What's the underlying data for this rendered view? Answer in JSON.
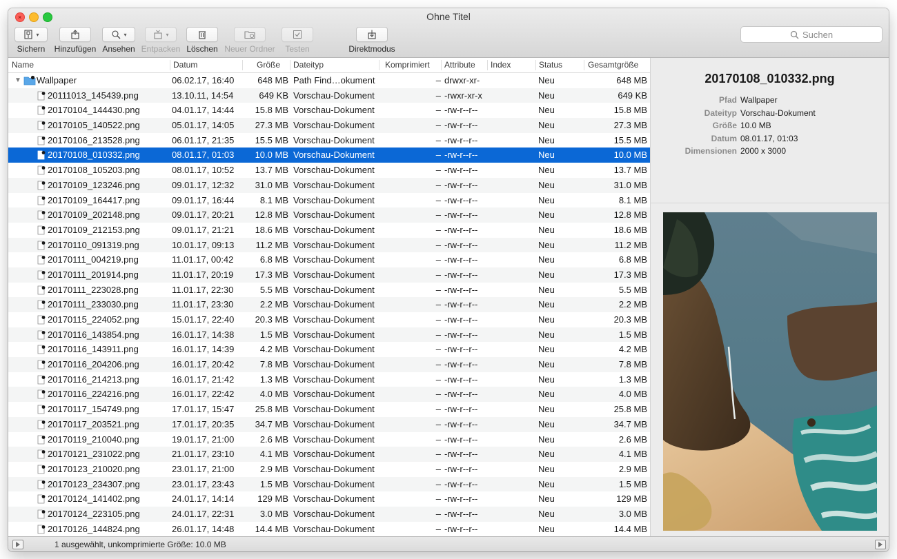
{
  "window": {
    "title": "Ohne Titel"
  },
  "toolbar": {
    "items": [
      {
        "label": "Sichern",
        "icon": "archive-icon",
        "enabled": true,
        "dropdown": true
      },
      {
        "label": "Hinzufügen",
        "icon": "add-icon",
        "enabled": true
      },
      {
        "label": "Ansehen",
        "icon": "view-icon",
        "enabled": true,
        "dropdown": true
      },
      {
        "label": "Entpacken",
        "icon": "extract-icon",
        "enabled": false,
        "dropdown": true
      },
      {
        "label": "Löschen",
        "icon": "trash-icon",
        "enabled": true
      },
      {
        "label": "Neuer Ordner",
        "icon": "new-folder-icon",
        "enabled": false
      },
      {
        "label": "Testen",
        "icon": "checkmark-icon",
        "enabled": false
      },
      {
        "label": "Direktmodus",
        "icon": "direct-mode-icon",
        "enabled": true
      }
    ],
    "search_placeholder": "Suchen"
  },
  "columns": [
    "Name",
    "Datum",
    "Größe",
    "Dateityp",
    "Komprimiert",
    "Attribute",
    "Index",
    "Status",
    "Gesamtgröße"
  ],
  "folder": {
    "name": "Wallpaper",
    "date": "06.02.17, 16:40",
    "size": "648 MB",
    "type": "Path Find…okument",
    "compressed": "–",
    "attr": "drwxr-xr-",
    "status": "Neu",
    "total": "648 MB"
  },
  "rows": [
    {
      "name": "20111013_145439.png",
      "date": "13.10.11, 14:54",
      "size": "649 KB",
      "type": "Vorschau-Dokument",
      "compressed": "–",
      "attr": "-rwxr-xr-x",
      "status": "Neu",
      "total": "649 KB"
    },
    {
      "name": "20170104_144430.png",
      "date": "04.01.17, 14:44",
      "size": "15.8 MB",
      "type": "Vorschau-Dokument",
      "compressed": "–",
      "attr": "-rw-r--r--",
      "status": "Neu",
      "total": "15.8 MB"
    },
    {
      "name": "20170105_140522.png",
      "date": "05.01.17, 14:05",
      "size": "27.3 MB",
      "type": "Vorschau-Dokument",
      "compressed": "–",
      "attr": "-rw-r--r--",
      "status": "Neu",
      "total": "27.3 MB"
    },
    {
      "name": "20170106_213528.png",
      "date": "06.01.17, 21:35",
      "size": "15.5 MB",
      "type": "Vorschau-Dokument",
      "compressed": "–",
      "attr": "-rw-r--r--",
      "status": "Neu",
      "total": "15.5 MB"
    },
    {
      "name": "20170108_010332.png",
      "date": "08.01.17, 01:03",
      "size": "10.0 MB",
      "type": "Vorschau-Dokument",
      "compressed": "–",
      "attr": "-rw-r--r--",
      "status": "Neu",
      "total": "10.0 MB",
      "selected": true
    },
    {
      "name": "20170108_105203.png",
      "date": "08.01.17, 10:52",
      "size": "13.7 MB",
      "type": "Vorschau-Dokument",
      "compressed": "–",
      "attr": "-rw-r--r--",
      "status": "Neu",
      "total": "13.7 MB"
    },
    {
      "name": "20170109_123246.png",
      "date": "09.01.17, 12:32",
      "size": "31.0 MB",
      "type": "Vorschau-Dokument",
      "compressed": "–",
      "attr": "-rw-r--r--",
      "status": "Neu",
      "total": "31.0 MB"
    },
    {
      "name": "20170109_164417.png",
      "date": "09.01.17, 16:44",
      "size": "8.1 MB",
      "type": "Vorschau-Dokument",
      "compressed": "–",
      "attr": "-rw-r--r--",
      "status": "Neu",
      "total": "8.1 MB"
    },
    {
      "name": "20170109_202148.png",
      "date": "09.01.17, 20:21",
      "size": "12.8 MB",
      "type": "Vorschau-Dokument",
      "compressed": "–",
      "attr": "-rw-r--r--",
      "status": "Neu",
      "total": "12.8 MB"
    },
    {
      "name": "20170109_212153.png",
      "date": "09.01.17, 21:21",
      "size": "18.6 MB",
      "type": "Vorschau-Dokument",
      "compressed": "–",
      "attr": "-rw-r--r--",
      "status": "Neu",
      "total": "18.6 MB"
    },
    {
      "name": "20170110_091319.png",
      "date": "10.01.17, 09:13",
      "size": "11.2 MB",
      "type": "Vorschau-Dokument",
      "compressed": "–",
      "attr": "-rw-r--r--",
      "status": "Neu",
      "total": "11.2 MB"
    },
    {
      "name": "20170111_004219.png",
      "date": "11.01.17, 00:42",
      "size": "6.8 MB",
      "type": "Vorschau-Dokument",
      "compressed": "–",
      "attr": "-rw-r--r--",
      "status": "Neu",
      "total": "6.8 MB"
    },
    {
      "name": "20170111_201914.png",
      "date": "11.01.17, 20:19",
      "size": "17.3 MB",
      "type": "Vorschau-Dokument",
      "compressed": "–",
      "attr": "-rw-r--r--",
      "status": "Neu",
      "total": "17.3 MB"
    },
    {
      "name": "20170111_223028.png",
      "date": "11.01.17, 22:30",
      "size": "5.5 MB",
      "type": "Vorschau-Dokument",
      "compressed": "–",
      "attr": "-rw-r--r--",
      "status": "Neu",
      "total": "5.5 MB"
    },
    {
      "name": "20170111_233030.png",
      "date": "11.01.17, 23:30",
      "size": "2.2 MB",
      "type": "Vorschau-Dokument",
      "compressed": "–",
      "attr": "-rw-r--r--",
      "status": "Neu",
      "total": "2.2 MB"
    },
    {
      "name": "20170115_224052.png",
      "date": "15.01.17, 22:40",
      "size": "20.3 MB",
      "type": "Vorschau-Dokument",
      "compressed": "–",
      "attr": "-rw-r--r--",
      "status": "Neu",
      "total": "20.3 MB"
    },
    {
      "name": "20170116_143854.png",
      "date": "16.01.17, 14:38",
      "size": "1.5 MB",
      "type": "Vorschau-Dokument",
      "compressed": "–",
      "attr": "-rw-r--r--",
      "status": "Neu",
      "total": "1.5 MB"
    },
    {
      "name": "20170116_143911.png",
      "date": "16.01.17, 14:39",
      "size": "4.2 MB",
      "type": "Vorschau-Dokument",
      "compressed": "–",
      "attr": "-rw-r--r--",
      "status": "Neu",
      "total": "4.2 MB"
    },
    {
      "name": "20170116_204206.png",
      "date": "16.01.17, 20:42",
      "size": "7.8 MB",
      "type": "Vorschau-Dokument",
      "compressed": "–",
      "attr": "-rw-r--r--",
      "status": "Neu",
      "total": "7.8 MB"
    },
    {
      "name": "20170116_214213.png",
      "date": "16.01.17, 21:42",
      "size": "1.3 MB",
      "type": "Vorschau-Dokument",
      "compressed": "–",
      "attr": "-rw-r--r--",
      "status": "Neu",
      "total": "1.3 MB"
    },
    {
      "name": "20170116_224216.png",
      "date": "16.01.17, 22:42",
      "size": "4.0 MB",
      "type": "Vorschau-Dokument",
      "compressed": "–",
      "attr": "-rw-r--r--",
      "status": "Neu",
      "total": "4.0 MB"
    },
    {
      "name": "20170117_154749.png",
      "date": "17.01.17, 15:47",
      "size": "25.8 MB",
      "type": "Vorschau-Dokument",
      "compressed": "–",
      "attr": "-rw-r--r--",
      "status": "Neu",
      "total": "25.8 MB"
    },
    {
      "name": "20170117_203521.png",
      "date": "17.01.17, 20:35",
      "size": "34.7 MB",
      "type": "Vorschau-Dokument",
      "compressed": "–",
      "attr": "-rw-r--r--",
      "status": "Neu",
      "total": "34.7 MB"
    },
    {
      "name": "20170119_210040.png",
      "date": "19.01.17, 21:00",
      "size": "2.6 MB",
      "type": "Vorschau-Dokument",
      "compressed": "–",
      "attr": "-rw-r--r--",
      "status": "Neu",
      "total": "2.6 MB"
    },
    {
      "name": "20170121_231022.png",
      "date": "21.01.17, 23:10",
      "size": "4.1 MB",
      "type": "Vorschau-Dokument",
      "compressed": "–",
      "attr": "-rw-r--r--",
      "status": "Neu",
      "total": "4.1 MB"
    },
    {
      "name": "20170123_210020.png",
      "date": "23.01.17, 21:00",
      "size": "2.9 MB",
      "type": "Vorschau-Dokument",
      "compressed": "–",
      "attr": "-rw-r--r--",
      "status": "Neu",
      "total": "2.9 MB"
    },
    {
      "name": "20170123_234307.png",
      "date": "23.01.17, 23:43",
      "size": "1.5 MB",
      "type": "Vorschau-Dokument",
      "compressed": "–",
      "attr": "-rw-r--r--",
      "status": "Neu",
      "total": "1.5 MB"
    },
    {
      "name": "20170124_141402.png",
      "date": "24.01.17, 14:14",
      "size": "129 MB",
      "type": "Vorschau-Dokument",
      "compressed": "–",
      "attr": "-rw-r--r--",
      "status": "Neu",
      "total": "129 MB"
    },
    {
      "name": "20170124_223105.png",
      "date": "24.01.17, 22:31",
      "size": "3.0 MB",
      "type": "Vorschau-Dokument",
      "compressed": "–",
      "attr": "-rw-r--r--",
      "status": "Neu",
      "total": "3.0 MB"
    },
    {
      "name": "20170126_144824.png",
      "date": "26.01.17, 14:48",
      "size": "14.4 MB",
      "type": "Vorschau-Dokument",
      "compressed": "–",
      "attr": "-rw-r--r--",
      "status": "Neu",
      "total": "14.4 MB"
    }
  ],
  "info": {
    "title": "20170108_010332.png",
    "fields": [
      {
        "key": "Pfad",
        "value": "Wallpaper"
      },
      {
        "key": "Dateityp",
        "value": "Vorschau-Dokument"
      },
      {
        "key": "Größe",
        "value": "10.0 MB"
      },
      {
        "key": "Datum",
        "value": "08.01.17, 01:03"
      },
      {
        "key": "Dimensionen",
        "value": "2000 x 3000"
      }
    ]
  },
  "status_bar": {
    "text": "1 ausgewählt, unkomprimierte Größe: 10.0 MB"
  },
  "colors": {
    "selection": "#0b68d6",
    "folder": "#5aa7e8"
  }
}
